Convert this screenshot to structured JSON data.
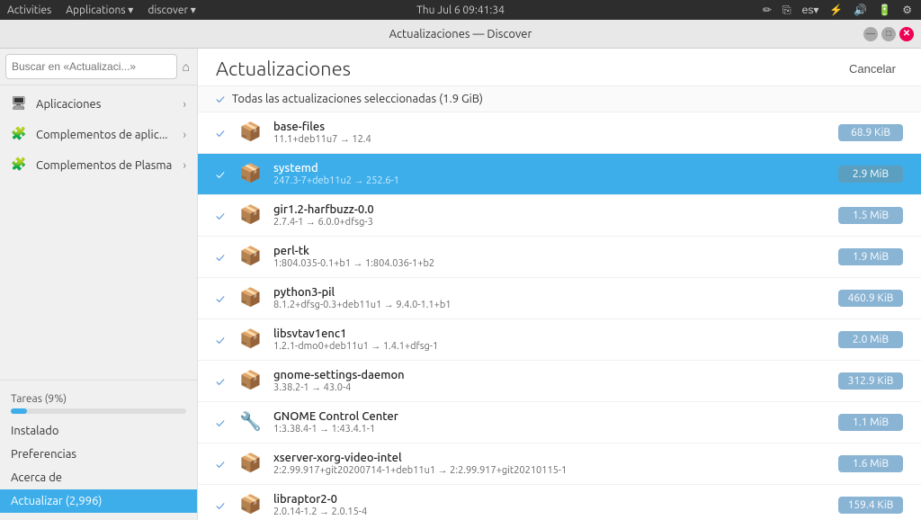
{
  "system_bar": {
    "activities": "Activities",
    "applications": "Applications",
    "app_arrow": "▾",
    "discover": "discover",
    "discover_arrow": "▾",
    "datetime": "Thu Jul 6  09:41:34",
    "edit_icon": "✏",
    "clipboard_icon": "⎘",
    "lang": "es",
    "lang_arrow": "▾",
    "bluetooth_icon": "⚡",
    "volume_icon": "🔊",
    "battery_icon": "🔋",
    "settings_icon": "⚙"
  },
  "titlebar": {
    "title": "Actualizaciones — Discover",
    "min_label": "—",
    "max_label": "□",
    "close_label": "✕"
  },
  "sidebar": {
    "search_placeholder": "Buscar en «Actualizaci...»",
    "home_icon": "⌂",
    "nav_items": [
      {
        "label": "Aplicaciones",
        "icon": "🖥",
        "has_arrow": true
      },
      {
        "label": "Complementos de aplic...",
        "icon": "🧩",
        "has_arrow": true
      },
      {
        "label": "Complementos de Plasma",
        "icon": "🧩",
        "has_arrow": true
      }
    ],
    "progress_label": "Tareas (9%)",
    "progress_percent": 9,
    "bottom_items": [
      {
        "label": "Instalado",
        "active": false
      },
      {
        "label": "Preferencias",
        "active": false
      },
      {
        "label": "Acerca de",
        "active": false
      },
      {
        "label": "Actualizar (2,996)",
        "active": true
      }
    ]
  },
  "content": {
    "title": "Actualizaciones",
    "cancel_label": "Cancelar",
    "select_all_label": "Todas las actualizaciones seleccionadas (1.9 GiB)",
    "packages": [
      {
        "name": "base-files",
        "version": "11.1+deb11u7 → 12.4",
        "size": "68.9 KiB",
        "checked": true,
        "selected": false,
        "icon": "📦"
      },
      {
        "name": "systemd",
        "version": "247.3-7+deb11u2 → 252.6-1",
        "size": "2.9 MiB",
        "checked": true,
        "selected": true,
        "icon": "📦"
      },
      {
        "name": "gir1.2-harfbuzz-0.0",
        "version": "2.7.4-1 → 6.0.0+dfsg-3",
        "size": "1.5 MiB",
        "checked": true,
        "selected": false,
        "icon": "📦"
      },
      {
        "name": "perl-tk",
        "version": "1:804.035-0.1+b1 → 1:804.036-1+b2",
        "size": "1.9 MiB",
        "checked": true,
        "selected": false,
        "icon": "📦"
      },
      {
        "name": "python3-pil",
        "version": "8.1.2+dfsg-0.3+deb11u1 → 9.4.0-1.1+b1",
        "size": "460.9 KiB",
        "checked": true,
        "selected": false,
        "icon": "📦"
      },
      {
        "name": "libsvtav1enc1",
        "version": "1.2.1-dmo0+deb11u1 → 1.4.1+dfsg-1",
        "size": "2.0 MiB",
        "checked": true,
        "selected": false,
        "icon": "📦"
      },
      {
        "name": "gnome-settings-daemon",
        "version": "3.38.2-1 → 43.0-4",
        "size": "312.9 KiB",
        "checked": true,
        "selected": false,
        "icon": "📦"
      },
      {
        "name": "GNOME Control Center",
        "version": "1:3.38.4-1 → 1:43.4.1-1",
        "size": "1.1 MiB",
        "checked": true,
        "selected": false,
        "icon": "🔧"
      },
      {
        "name": "xserver-xorg-video-intel",
        "version": "2:2.99.917+git20200714-1+deb11u1 → 2:2.99.917+git20210115-1",
        "size": "1.6 MiB",
        "checked": true,
        "selected": false,
        "icon": "📦"
      },
      {
        "name": "libraptor2-0",
        "version": "2.0.14-1.2 → 2.0.15-4",
        "size": "159.4 KiB",
        "checked": true,
        "selected": false,
        "icon": "📦"
      }
    ]
  }
}
